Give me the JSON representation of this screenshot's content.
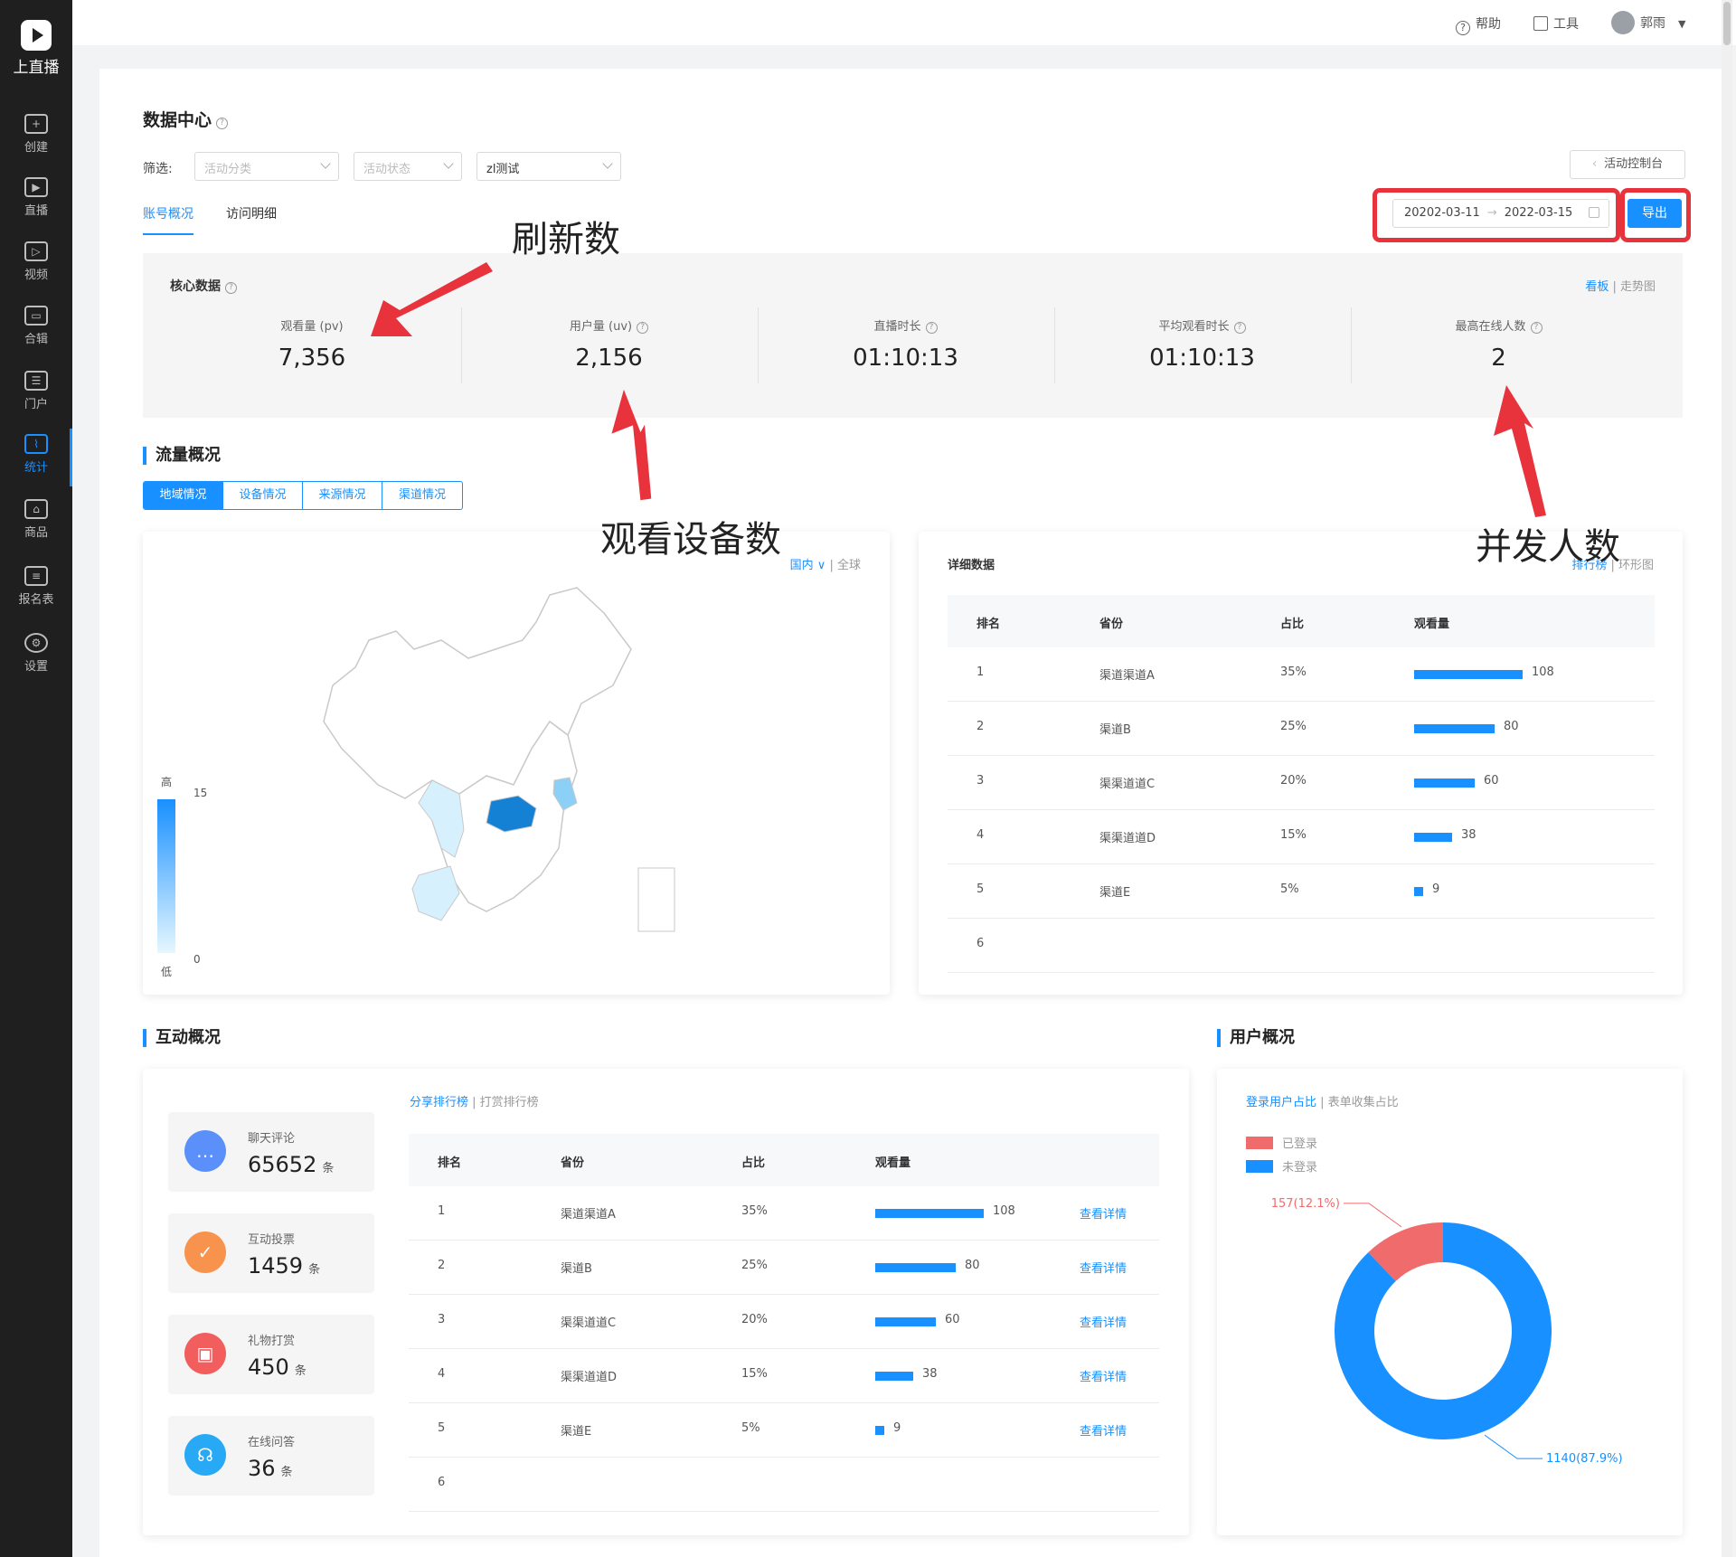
{
  "app": {
    "logo_text": "上直播"
  },
  "sidebar": {
    "items": [
      {
        "label": "创建",
        "icon": "plus-square-icon"
      },
      {
        "label": "直播",
        "icon": "play-screen-icon"
      },
      {
        "label": "视频",
        "icon": "film-icon"
      },
      {
        "label": "合辑",
        "icon": "wallet-icon"
      },
      {
        "label": "门户",
        "icon": "portal-icon"
      },
      {
        "label": "统计",
        "icon": "line-chart-icon",
        "active": true
      },
      {
        "label": "商品",
        "icon": "shopping-bag-icon"
      },
      {
        "label": "报名表",
        "icon": "form-icon"
      },
      {
        "label": "设置",
        "icon": "gear-icon"
      }
    ]
  },
  "topbar": {
    "help": "帮助",
    "tools": "工具",
    "user": "郭雨"
  },
  "page": {
    "title": "数据中心"
  },
  "filters": {
    "label": "筛选:",
    "category_placeholder": "活动分类",
    "status_placeholder": "活动状态",
    "activity_value": "zl测试"
  },
  "control_button": "活动控制台",
  "tabs": {
    "overview": "账号概况",
    "detail": "访问明细"
  },
  "date_range": {
    "start": "20202-03-11",
    "sep": "→",
    "end": "2022-03-15"
  },
  "export_label": "导出",
  "core": {
    "title": "核心数据",
    "view_board": "看板",
    "view_trend": "走势图",
    "metrics": [
      {
        "label": "观看量 (pv)",
        "value": "7,356"
      },
      {
        "label": "用户量 (uv)",
        "value": "2,156"
      },
      {
        "label": "直播时长",
        "value": "01:10:13"
      },
      {
        "label": "平均观看时长",
        "value": "01:10:13"
      },
      {
        "label": "最高在线人数",
        "value": "2"
      }
    ]
  },
  "traffic": {
    "title": "流量概况",
    "segments": [
      "地域情况",
      "设备情况",
      "来源情况",
      "渠道情况"
    ],
    "map": {
      "domestic": "国内",
      "global": "全球",
      "legend_high": "高",
      "legend_low": "低",
      "legend_max": "15",
      "legend_min": "0"
    },
    "detail": {
      "title": "详细数据",
      "view_rank": "排行榜",
      "view_ring": "环形图",
      "headers": [
        "排名",
        "省份",
        "占比",
        "观看量"
      ],
      "rows": [
        {
          "rank": "1",
          "name": "渠道渠道A",
          "pct": "35%",
          "views": 108
        },
        {
          "rank": "2",
          "name": "渠道B",
          "pct": "25%",
          "views": 80
        },
        {
          "rank": "3",
          "name": "渠渠道道C",
          "pct": "20%",
          "views": 60
        },
        {
          "rank": "4",
          "name": "渠渠道道D",
          "pct": "15%",
          "views": 38
        },
        {
          "rank": "5",
          "name": "渠道E",
          "pct": "5%",
          "views": 9
        },
        {
          "rank": "6",
          "name": "",
          "pct": "",
          "views": null
        }
      ]
    }
  },
  "interaction": {
    "title": "互动概况",
    "stats": [
      {
        "label": "聊天评论",
        "value": "65652",
        "unit": "条",
        "color": "#5b8ff9",
        "icon": "chat-icon"
      },
      {
        "label": "互动投票",
        "value": "1459",
        "unit": "条",
        "color": "#f7934c",
        "icon": "vote-icon"
      },
      {
        "label": "礼物打赏",
        "value": "450",
        "unit": "条",
        "color": "#f25d5d",
        "icon": "gift-icon"
      },
      {
        "label": "在线问答",
        "value": "36",
        "unit": "条",
        "color": "#27a9f5",
        "icon": "headset-icon"
      }
    ],
    "view_share": "分享排行榜",
    "view_reward": "打赏排行榜",
    "headers": [
      "排名",
      "省份",
      "占比",
      "观看量"
    ],
    "detail_link": "查看详情",
    "rows": [
      {
        "rank": "1",
        "name": "渠道渠道A",
        "pct": "35%",
        "views": 108
      },
      {
        "rank": "2",
        "name": "渠道B",
        "pct": "25%",
        "views": 80
      },
      {
        "rank": "3",
        "name": "渠渠道道C",
        "pct": "20%",
        "views": 60
      },
      {
        "rank": "4",
        "name": "渠渠道道D",
        "pct": "15%",
        "views": 38
      },
      {
        "rank": "5",
        "name": "渠道E",
        "pct": "5%",
        "views": 9
      },
      {
        "rank": "6",
        "name": "",
        "pct": "",
        "views": null
      }
    ]
  },
  "users": {
    "title": "用户概况",
    "view_login": "登录用户占比",
    "view_form": "表单收集占比",
    "chart_data": {
      "type": "pie",
      "categories": [
        "已登录",
        "未登录"
      ],
      "values": [
        157,
        1140
      ],
      "labels": [
        "157(12.1%)",
        "1140(87.9%)"
      ],
      "colors": [
        "#f06b6b",
        "#1890ff"
      ],
      "legend": "top-left"
    }
  },
  "annotations": {
    "refresh": "刷新数",
    "devices": "观看设备数",
    "concurrent": "并发人数"
  },
  "colors": {
    "accent": "#1890ff",
    "annotation_red": "#e8323c"
  }
}
